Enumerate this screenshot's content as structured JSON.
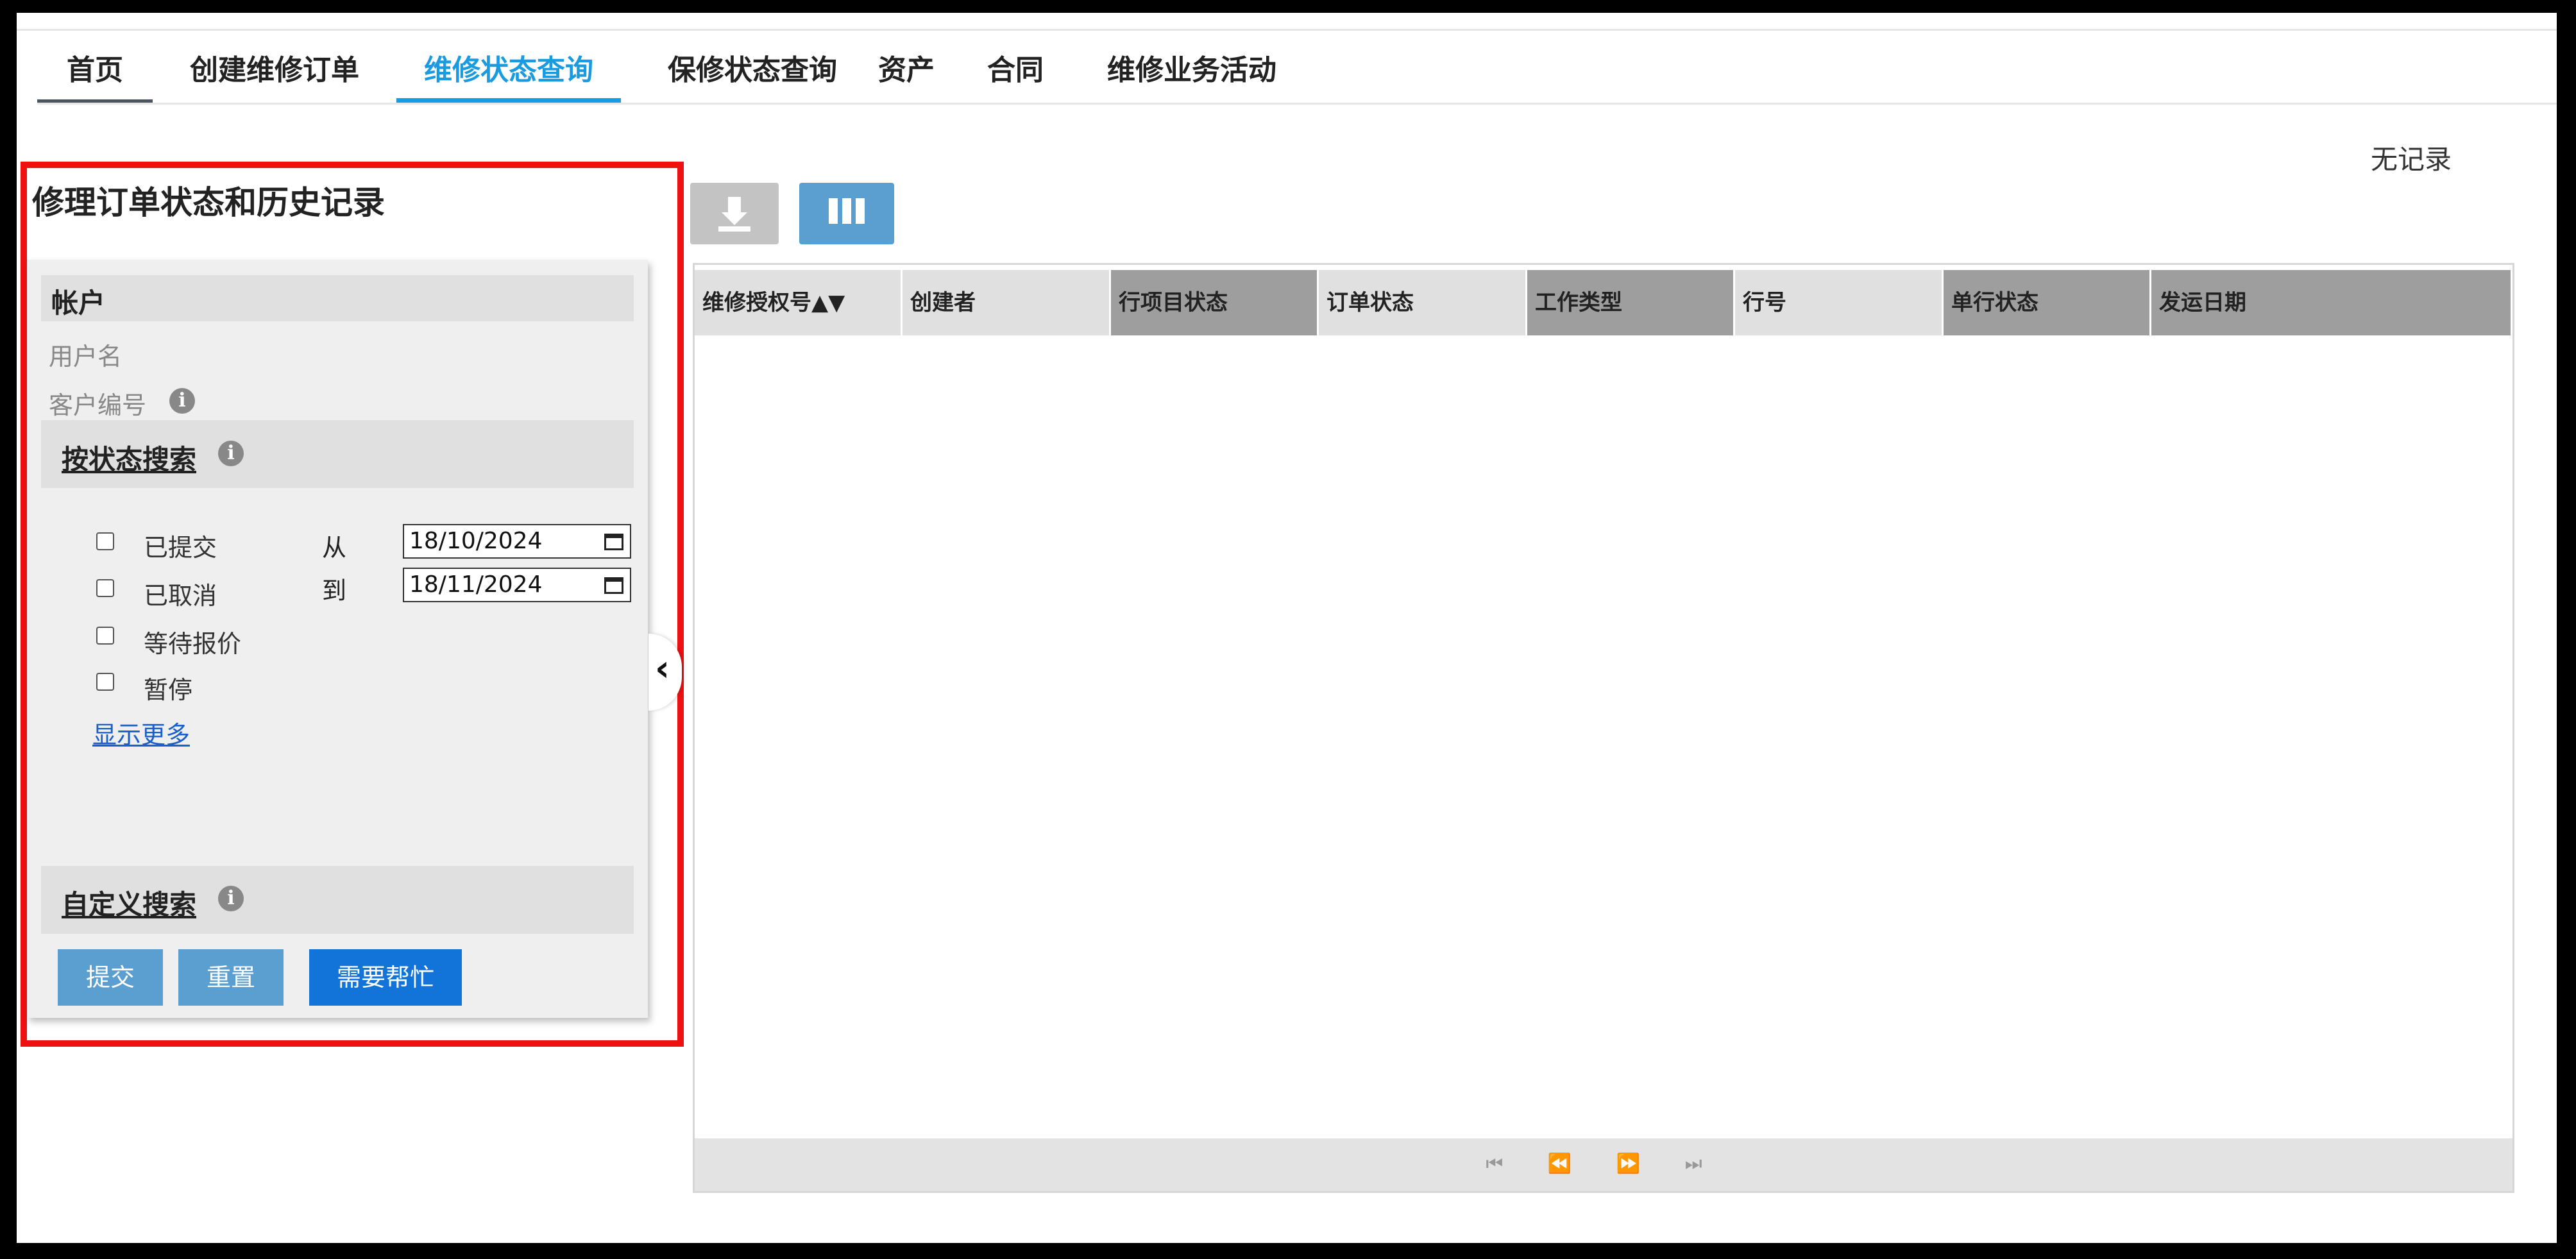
{
  "nav": {
    "tabs": [
      {
        "label": "首页"
      },
      {
        "label": "创建维修订单"
      },
      {
        "label": "维修状态查询",
        "active": true
      },
      {
        "label": "保修状态查询"
      },
      {
        "label": "资产"
      },
      {
        "label": "合同"
      },
      {
        "label": "维修业务活动"
      }
    ]
  },
  "status": {
    "no_records": "无记录"
  },
  "panel": {
    "title": "修理订单状态和历史记录",
    "account": {
      "heading": "帐户",
      "username_label": "用户名",
      "customer_number_label": "客户编号"
    },
    "status_search": {
      "heading": "按状态搜索",
      "options": [
        {
          "label": "已提交",
          "checked": false
        },
        {
          "label": "已取消",
          "checked": false
        },
        {
          "label": "等待报价",
          "checked": false
        },
        {
          "label": "暂停",
          "checked": false
        }
      ],
      "from_label": "从",
      "to_label": "到",
      "from_date": "18/10/2024",
      "to_date": "18/11/2024",
      "show_more": "显示更多"
    },
    "custom_search": {
      "heading": "自定义搜索"
    },
    "buttons": {
      "submit": "提交",
      "reset": "重置",
      "help": "需要帮忙"
    }
  },
  "grid": {
    "columns": [
      {
        "label": "维修授权号▲▼"
      },
      {
        "label": "创建者"
      },
      {
        "label": "行项目状态"
      },
      {
        "label": "订单状态"
      },
      {
        "label": "工作类型"
      },
      {
        "label": "行号"
      },
      {
        "label": "单行状态"
      },
      {
        "label": "发运日期"
      }
    ],
    "rows": [],
    "pager": "⏮ ⏪ ⏩ ⏭"
  },
  "colors": {
    "accent": "#1a9be0",
    "highlight_border": "#ee1111",
    "button_primary": "#1273d8",
    "button_secondary": "#5a9fcf"
  }
}
